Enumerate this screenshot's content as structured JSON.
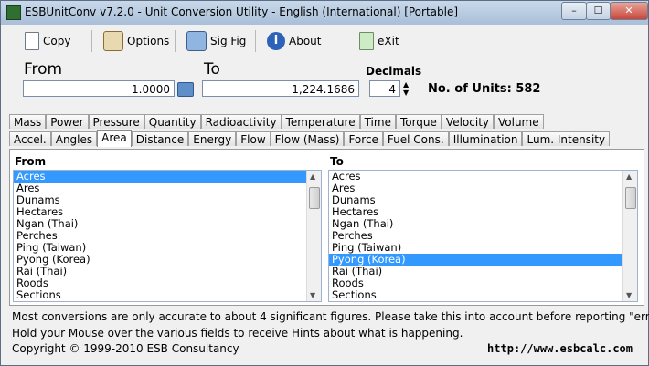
{
  "window": {
    "title": "ESBUnitConv v7.2.0 - Unit Conversion Utility - English (International) [Portable]",
    "minimize_label": "–",
    "maximize_label": "☐",
    "close_label": "✕"
  },
  "toolbar": {
    "copy_label": "Copy",
    "options_label": "Options",
    "sigfig_label": "Sig Fig",
    "about_label": "About",
    "exit_label": "eXit"
  },
  "converter": {
    "from_label": "From",
    "to_label": "To",
    "decimals_label": "Decimals",
    "from_value": "1.0000",
    "to_value": "1,224.1686",
    "decimals_value": "4",
    "units_count_text": "No. of Units: 582"
  },
  "tabs": {
    "row1": [
      "Mass",
      "Power",
      "Pressure",
      "Quantity",
      "Radioactivity",
      "Temperature",
      "Time",
      "Torque",
      "Velocity",
      "Volume"
    ],
    "row2": [
      "Accel.",
      "Angles",
      "Area",
      "Distance",
      "Energy",
      "Flow",
      "Flow (Mass)",
      "Force",
      "Fuel Cons.",
      "Illumination",
      "Lum. Intensity"
    ],
    "active": "Area"
  },
  "lists": {
    "from_header": "From",
    "to_header": "To",
    "from_items": [
      "Acres",
      "Ares",
      "Dunams",
      "Hectares",
      "Ngan (Thai)",
      "Perches",
      "Ping (Taiwan)",
      "Pyong (Korea)",
      "Rai (Thai)",
      "Roods",
      "Sections"
    ],
    "to_items": [
      "Acres",
      "Ares",
      "Dunams",
      "Hectares",
      "Ngan (Thai)",
      "Perches",
      "Ping (Taiwan)",
      "Pyong (Korea)",
      "Rai (Thai)",
      "Roods",
      "Sections"
    ],
    "from_selected": "Acres",
    "to_selected": "Pyong (Korea)"
  },
  "status": {
    "line1": "Most conversions are only accurate to about 4 significant figures. Please take this into account before reporting \"errors\".",
    "line2": "Hold your Mouse over the various fields to receive Hints about what is happening.",
    "copyright": "Copyright © 1999-2010 ESB Consultancy",
    "url": "http://www.esbcalc.com"
  },
  "colors": {
    "selection": "#3399ff",
    "titlebar": "#b9cce3"
  }
}
